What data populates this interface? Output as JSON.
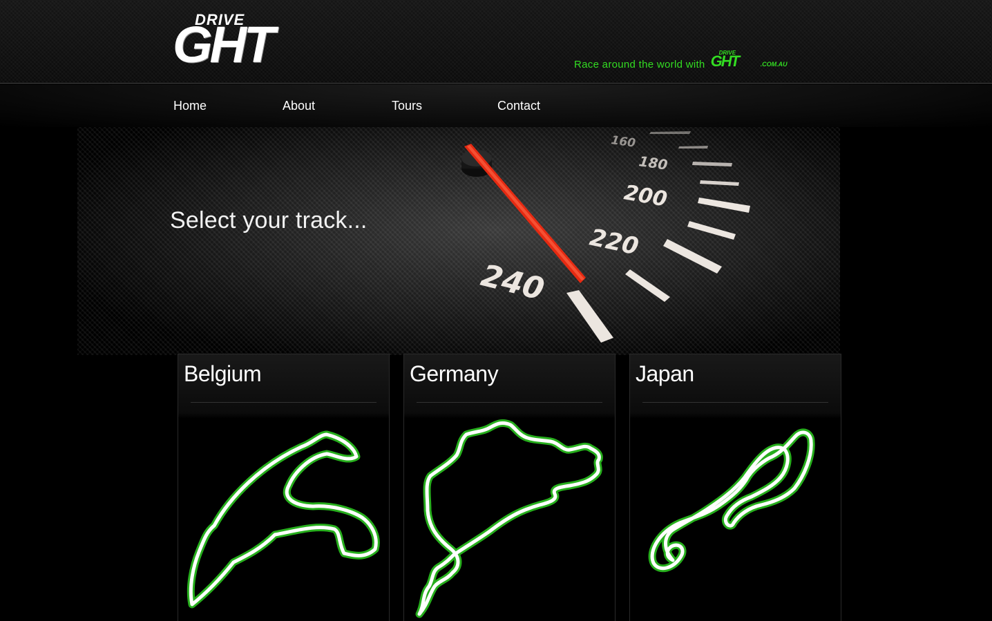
{
  "brand": {
    "logo_small": "DRIVE",
    "logo_big": "GHT",
    "tagline": "Race around the world with",
    "tagline_logo_small": "DRIVE",
    "tagline_logo_big": "GHT",
    "tagline_logo_domain": ".COM.AU",
    "accent_color": "#33dd22"
  },
  "nav": {
    "items": [
      {
        "label": "Home"
      },
      {
        "label": "About"
      },
      {
        "label": "Tours"
      },
      {
        "label": "Contact"
      }
    ]
  },
  "hero": {
    "title": "Select your track...",
    "speedometer_labels": [
      "160",
      "180",
      "200",
      "220",
      "240"
    ]
  },
  "tracks": [
    {
      "country": "Belgium"
    },
    {
      "country": "Germany"
    },
    {
      "country": "Japan"
    }
  ]
}
